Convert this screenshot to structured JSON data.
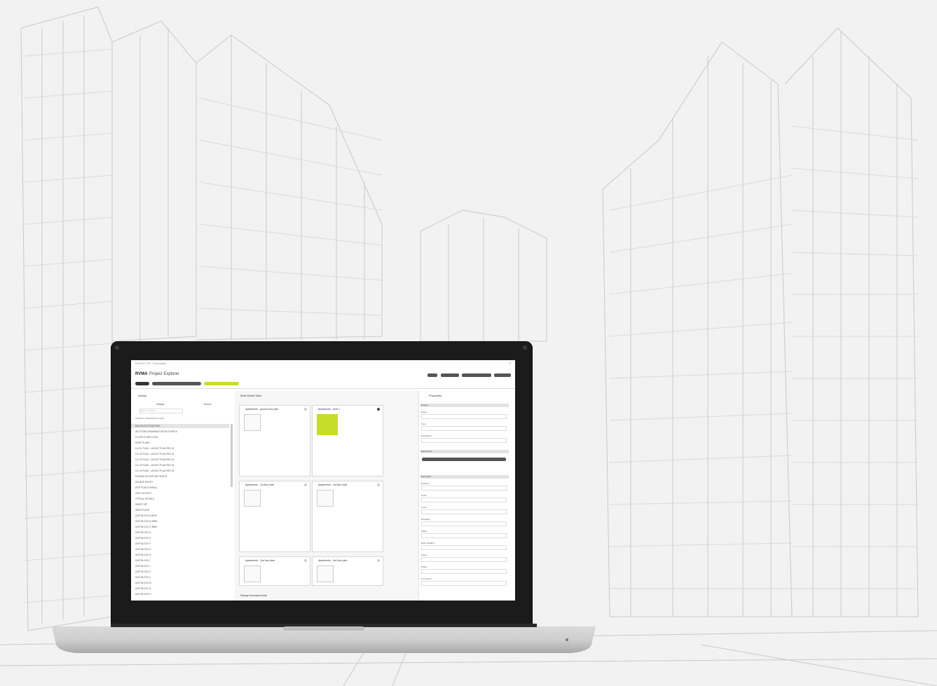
{
  "app": {
    "window_title": "PROJECT 3D - Presentation",
    "logo": "RVMA",
    "title": "Project Explorer",
    "breadcrumbs": [
      "ALL",
      "ALL BUILDINGS > LEVEL SHEETS",
      "AUTO GENERATED"
    ],
    "top_buttons": [
      "NEW",
      "IMPORT",
      "EXPORT VIEWS",
      "SETTINGS"
    ],
    "accent": "#c8dc2a"
  },
  "left_panel": {
    "title": "Library",
    "tabs": [
      "Settings",
      "Browse"
    ],
    "search_placeholder": "Search in library",
    "section_label": "LIBRARY REFERENCE FILES",
    "items": [
      "BUILDING ELEVATIONS",
      "SECTIONS DRAWINGS DETAIL SHEETS",
      "FLOOR PLANS LEVEL",
      "ROOF PLANS",
      "LVL 01 PLAN - LAYOUT PLAN REV 01",
      "LVL 02 PLAN - LAYOUT PLAN REV 02",
      "LVL 03 PLAN - LAYOUT PLAN REV 03",
      "LVL 04 PLAN - LAYOUT PLAN REV 04",
      "LVL 05 PLAN - LAYOUT PLAN REV 05",
      "FACADE ELEVATIONS NORTH",
      "FACADE SOUTH",
      "SITE PLAN OVERALL",
      "UNIT LAYOUTS",
      "TYPICAL DETAILS",
      "SHEET SET",
      "AREA PLANS",
      "UNIT BLOCK A 1BHK",
      "UNIT BLOCK B 2BHK",
      "UNIT BLOCK C 3BHK",
      "UNIT BLOCK D",
      "UNIT BLOCK E",
      "UNIT BLOCK F",
      "UNIT BLOCK G",
      "UNIT BLOCK H",
      "UNIT BLOCK I",
      "UNIT BLOCK J",
      "UNIT BLOCK K",
      "UNIT BLOCK L",
      "UNIT BLOCK M",
      "UNIT BLOCK N",
      "UNIT BLOCK O"
    ]
  },
  "center": {
    "title": "Multi-Sheet View",
    "cards": [
      {
        "title": "Apartments - ground floor plan",
        "selected": false
      },
      {
        "title": "Apartments - level 1",
        "selected": true
      },
      {
        "title": "Apartments - 1st floor plan",
        "selected": false
      },
      {
        "title": "Apartments - 1st floor (full)",
        "selected": false
      },
      {
        "title": "Apartments - 2nd floor plan",
        "selected": false
      },
      {
        "title": "Apartments - 3rd floor plan",
        "selected": false
      }
    ],
    "footer_label": "Display Document mode"
  },
  "right_panel": {
    "title": "Properties",
    "groups": [
      "General",
      "Attachments",
      "Data Fields"
    ],
    "labels": [
      "Name",
      "Type",
      "Description",
      "Revision",
      "Scale",
      "Level",
      "Discipline",
      "Status",
      "Date modified",
      "Owner",
      "Phase",
      "Comments"
    ]
  },
  "icons": [
    "close-icon",
    "expand-icon",
    "search-icon",
    "document-icon",
    "chevron-icon"
  ]
}
